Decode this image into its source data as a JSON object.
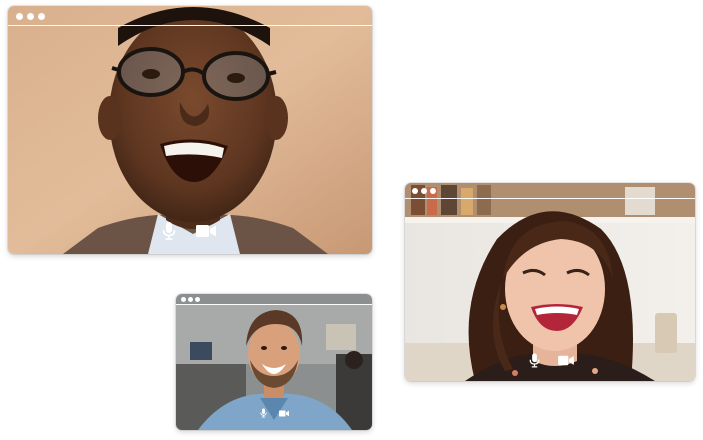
{
  "participants": [
    {
      "id": "participant-1",
      "controls": {
        "mic_icon": "microphone-icon",
        "camera_icon": "video-camera-icon"
      },
      "has_controls": true
    },
    {
      "id": "participant-2",
      "controls": {
        "mic_icon": "microphone-icon",
        "camera_icon": "video-camera-icon"
      },
      "has_controls": true
    },
    {
      "id": "participant-3",
      "controls": {
        "mic_icon": "microphone-icon",
        "camera_icon": "video-camera-icon"
      },
      "has_controls": true
    }
  ],
  "window_chrome": {
    "dot_icon": "window-control-dot-icon",
    "dot_count": 3
  },
  "colors": {
    "chrome_white": "#ffffff",
    "page_background": "#ffffff"
  }
}
